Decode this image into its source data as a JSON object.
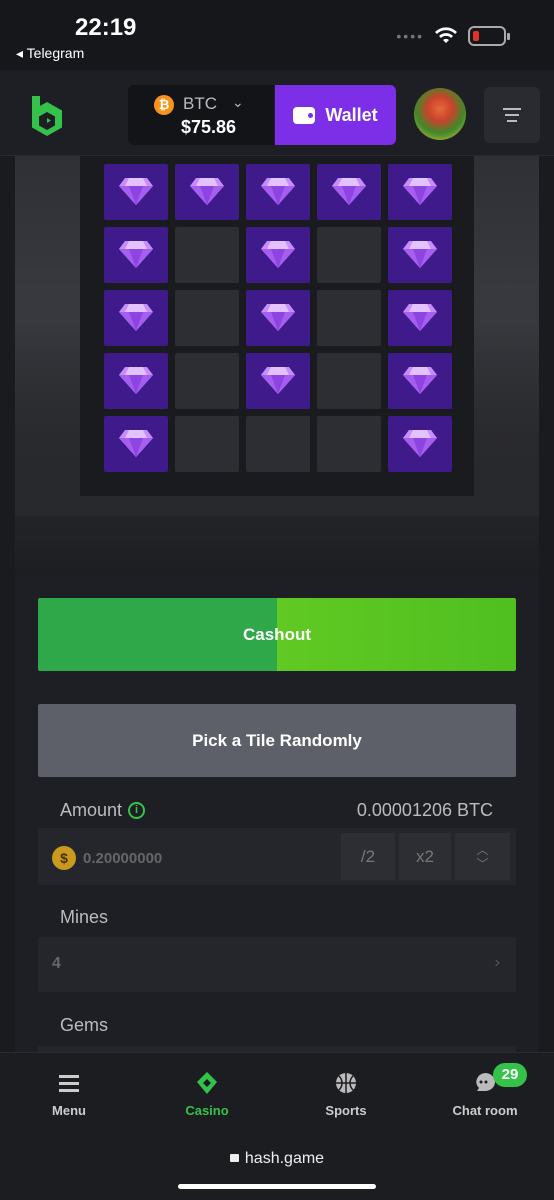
{
  "status_bar": {
    "time": "22:19",
    "back_app": "◂ Telegram"
  },
  "header": {
    "currency_code": "BTC",
    "balance": "$75.86",
    "wallet_label": "Wallet",
    "brand_color": "#35c24a",
    "wallet_color": "#7c2fe6"
  },
  "board": {
    "rows": [
      [
        "gem",
        "gem",
        "gem",
        "gem",
        "gem"
      ],
      [
        "gem",
        "hidden",
        "gem",
        "hidden",
        "gem"
      ],
      [
        "gem",
        "hidden",
        "gem",
        "hidden",
        "gem"
      ],
      [
        "gem",
        "hidden",
        "gem",
        "hidden",
        "gem"
      ],
      [
        "gem",
        "hidden",
        "hidden",
        "hidden",
        "gem"
      ]
    ]
  },
  "actions": {
    "cashout_label": "Cashout",
    "random_label": "Pick a Tile Randomly"
  },
  "bet": {
    "amount_label": "Amount",
    "amount_btc": "0.00001206 BTC",
    "amount_value": "0.20000000",
    "half_label": "/2",
    "double_label": "x2",
    "mines_label": "Mines",
    "mines_value": "4",
    "gems_label": "Gems"
  },
  "nav": {
    "menu": "Menu",
    "casino": "Casino",
    "sports": "Sports",
    "chat": "Chat room",
    "chat_badge": "29"
  },
  "url": "hash.game"
}
